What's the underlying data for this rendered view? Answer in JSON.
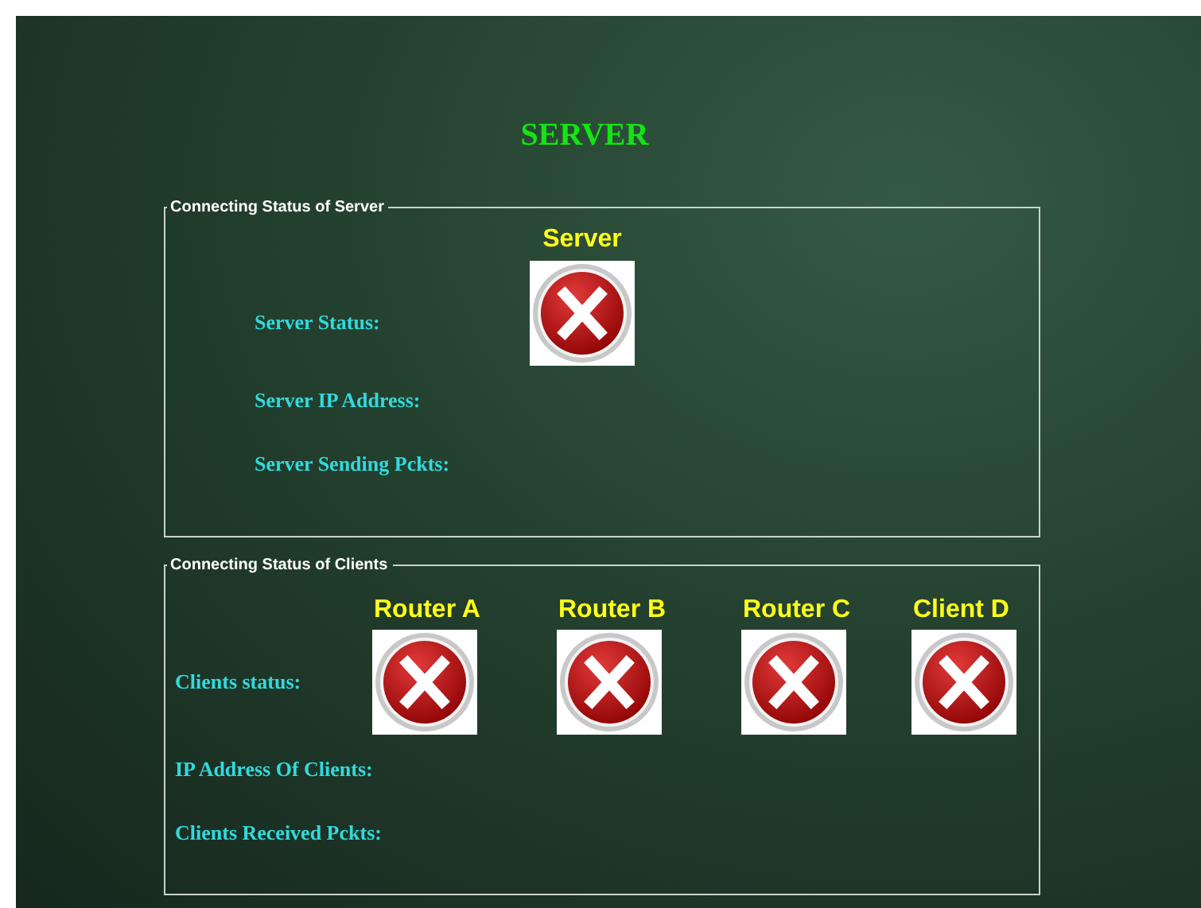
{
  "title": "SERVER",
  "server_group": {
    "legend": "Connecting Status of Server",
    "heading": "Server",
    "connected": false,
    "labels": [
      "Server Status:",
      "Server IP Address:",
      "Server Sending Pckts:"
    ]
  },
  "clients_group": {
    "legend": "Connecting Status of Clients",
    "labels": [
      "Clients status:",
      "IP Address Of Clients:",
      "Clients Received Pckts:"
    ],
    "nodes": [
      {
        "name": "Router A",
        "connected": false
      },
      {
        "name": "Router B",
        "connected": false
      },
      {
        "name": "Router C",
        "connected": false
      },
      {
        "name": "Client D",
        "connected": false
      }
    ]
  }
}
